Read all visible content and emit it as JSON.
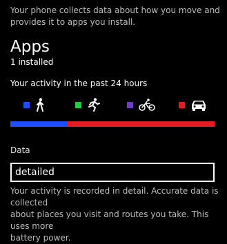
{
  "intro_text": "Your phone collects data about how you move and\nprovides it to apps you install.",
  "apps_section": {
    "title": "Apps",
    "subtitle": "1 installed"
  },
  "activity": {
    "label": "Your activity in the past 24 hours",
    "legend": [
      {
        "name": "walking",
        "color": "#1e4cff",
        "icon": "walking-person-icon"
      },
      {
        "name": "running",
        "color": "#19d23f",
        "icon": "running-person-icon"
      },
      {
        "name": "cycling",
        "color": "#6f3fbf",
        "icon": "bicycle-icon"
      },
      {
        "name": "driving",
        "color": "#e51b24",
        "icon": "car-icon"
      }
    ],
    "bar_fractions": {
      "walking": 0.28,
      "running": 0,
      "cycling": 0,
      "driving": 0.72
    }
  },
  "data_setting": {
    "label": "Data",
    "selected": "detailed",
    "description": "Your activity is recorded in detail. Accurate data is collected\nabout places you visit and routes you take. This uses more\nbattery power."
  }
}
